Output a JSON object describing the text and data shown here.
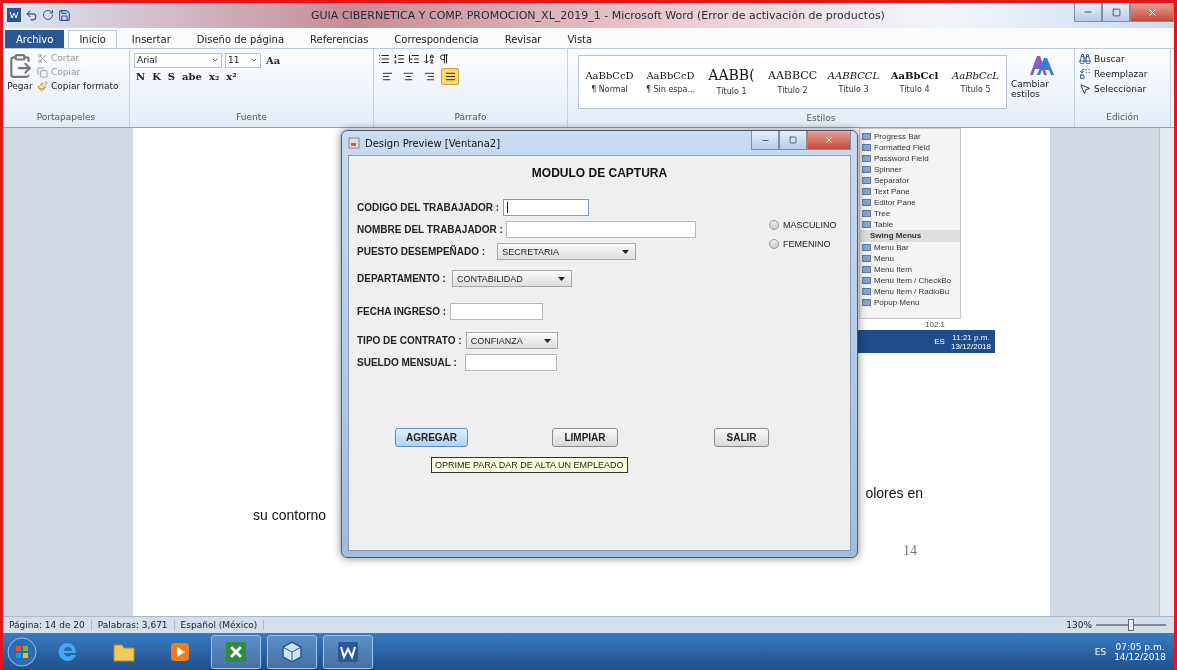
{
  "window": {
    "title": "GUIA CIBERNETICA Y COMP. PROMOCION_XL_2019_1  -  Microsoft Word (Error de activación de productos)"
  },
  "ribbon_tabs": [
    {
      "label": "Archivo",
      "kind": "file",
      "selected": false
    },
    {
      "label": "Inicio",
      "kind": "tab",
      "selected": true
    },
    {
      "label": "Insertar",
      "kind": "tab",
      "selected": false
    },
    {
      "label": "Diseño de página",
      "kind": "tab",
      "selected": false
    },
    {
      "label": "Referencias",
      "kind": "tab",
      "selected": false
    },
    {
      "label": "Correspondencia",
      "kind": "tab",
      "selected": false
    },
    {
      "label": "Revisar",
      "kind": "tab",
      "selected": false
    },
    {
      "label": "Vista",
      "kind": "tab",
      "selected": false
    }
  ],
  "clipboard": {
    "label": "Portapapeles",
    "paste": "Pegar",
    "items": [
      {
        "label": "Cortar",
        "kind": "cut",
        "disabled": true
      },
      {
        "label": "Copiar",
        "kind": "copy",
        "disabled": true
      },
      {
        "label": "Copiar formato",
        "kind": "brush",
        "disabled": false
      }
    ]
  },
  "font": {
    "label": "Fuente",
    "name": "Arial",
    "size": "11",
    "case_button": "Aa",
    "format_buttons": [
      "N",
      "K",
      "S",
      "abe",
      "x₂",
      "x²"
    ]
  },
  "paragraph": {
    "label": "Párrafo",
    "alignment": [
      {
        "selected": false
      },
      {
        "selected": false
      },
      {
        "selected": false
      },
      {
        "selected": true
      }
    ]
  },
  "styles": {
    "label": "Estilos",
    "gallery": [
      {
        "preview": "AaBbCcD",
        "name": "¶ Normal",
        "kind": "normal"
      },
      {
        "preview": "AaBbCcD",
        "name": "¶ Sin espa...",
        "kind": "normal"
      },
      {
        "preview": "AABB(",
        "name": "Título 1",
        "kind": "title1"
      },
      {
        "preview": "AABBCC",
        "name": "Título 2",
        "kind": "title2"
      },
      {
        "preview": "AABBCCL",
        "name": "Título 3",
        "kind": "title3"
      },
      {
        "preview": "AaBbCcl",
        "name": "Título 4",
        "kind": "title4"
      },
      {
        "preview": "AaBbCcL",
        "name": "Título 5",
        "kind": "title5"
      }
    ],
    "change": "Cambiar estilos"
  },
  "editing": {
    "label": "Edición",
    "items": [
      {
        "label": "Buscar",
        "kind": "find"
      },
      {
        "label": "Reemplazar",
        "kind": "replace"
      },
      {
        "label": "Seleccionar",
        "kind": "select"
      }
    ]
  },
  "document": {
    "embedded_screenshot": {
      "palette_items": [
        "Progress Bar",
        "Formatted Field",
        "Password Field",
        "Spinner",
        "Separator",
        "Text Pane",
        "Editor Pane",
        "Tree",
        "Table"
      ],
      "section": "Swing Menus",
      "menu_items": [
        "Menu Bar",
        "Menu",
        "Menu Item",
        "Menu Item / CheckBo",
        "Menu Item / RadioBu",
        "Popup Menu"
      ],
      "position": "102:1",
      "tray_language": "ES",
      "tray_time": "11:21 p.m.",
      "tray_date": "13/12/2018"
    },
    "text_lines": [
      "olores en",
      "su contorno"
    ],
    "page_number": "14"
  },
  "dialog": {
    "title": "Design Preview [Ventana2]",
    "heading": "MODULO DE CAPTURA",
    "fields": [
      {
        "label": "CODIGO DEL TRABAJADOR :",
        "kind": "text",
        "focused": true
      },
      {
        "label": "NOMBRE DEL TRABAJADOR :",
        "kind": "text",
        "focused": false
      },
      {
        "label": "PUESTO DESEMPEÑADO :",
        "kind": "combo",
        "value": "SECRETARIA"
      },
      {
        "label": "DEPARTAMENTO :",
        "kind": "combo",
        "value": "CONTABILIDAD"
      },
      {
        "label": "FECHA INGRESO :",
        "kind": "text",
        "focused": false
      },
      {
        "label": "TIPO DE CONTRATO :",
        "kind": "combo",
        "value": "CONFIANZA"
      },
      {
        "label": "SUELDO  MENSUAL :",
        "kind": "text",
        "focused": false
      }
    ],
    "radios": [
      {
        "label": "MASCULINO",
        "selected": false
      },
      {
        "label": "FEMENINO",
        "selected": false
      }
    ],
    "buttons": [
      {
        "label": "AGREGAR",
        "focused": true
      },
      {
        "label": "LIMPIAR",
        "focused": false
      },
      {
        "label": "SALIR",
        "focused": false
      }
    ],
    "tooltip": "OPRIME PARA DAR DE ALTA UN EMPLEADO"
  },
  "status_bar": {
    "page": "Página: 14 de 20",
    "words": "Palabras: 3,671",
    "language": "Español (México)",
    "zoom": "130%",
    "zoom_slider": {
      "level": 0.5
    }
  },
  "taskbar": {
    "apps": [
      {
        "kind": "browser",
        "active": false
      },
      {
        "kind": "folder",
        "active": false
      },
      {
        "kind": "media",
        "active": false
      },
      {
        "kind": "spreadsheet",
        "active": true
      },
      {
        "kind": "cube",
        "active": true
      },
      {
        "kind": "word",
        "active": true
      }
    ],
    "language": "ES",
    "time": "07:05 p.m.",
    "date": "14/12/2018"
  }
}
